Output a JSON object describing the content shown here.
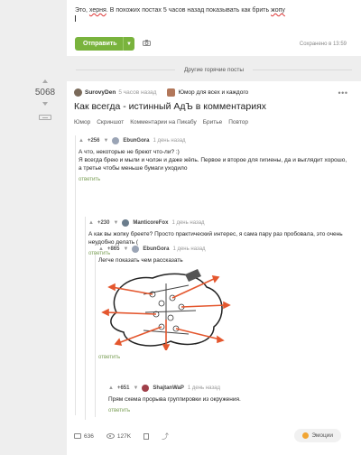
{
  "compose": {
    "text_before": "Это, ",
    "text_error1": "херня",
    "text_middle": ". В похожих постах 5 часов назад показывать как брить ",
    "text_error2": "жопу",
    "send_label": "Отправить",
    "saved_status": "Сохранено в 13:59"
  },
  "section_title": "Другие горячие посты",
  "post": {
    "rating": "5068",
    "author": "SurovyDen",
    "time": "5 часов назад",
    "community": "Юмор для всех и каждого",
    "title": "Как всегда - истинный АдЪ в комментариях",
    "tags": [
      "Юмор",
      "Скриншот",
      "Комментарии на Пикабу",
      "Бритье",
      "Повтор"
    ],
    "comments_count": "636",
    "views": "127K",
    "emotions_label": "Эмоции"
  },
  "comments": [
    {
      "rating": "+256",
      "user": "EbunGora",
      "time": "1 день назад",
      "lines": [
        "А что, некоторые не бреют что-ли? :)",
        "Я всегда брею и мыли и чолэн и даже жёпь. Первое и второе для гигиены, да и выглядит хорошо,",
        "а третье чтобы меньше бумаги уходило"
      ],
      "reply": "ответить"
    },
    {
      "rating": "+230",
      "user": "ManticoreFox",
      "time": "1 день назад",
      "lines": [
        "А как вы жопку бреете? Просто практический интерес, я сама пару раз пробовала, это очень",
        "неудобно делать ("
      ],
      "reply": "ответить"
    },
    {
      "rating": "+865",
      "user": "EbunGora",
      "time": "1 день назад",
      "lines": [
        "Легче показать чем рассказать"
      ],
      "reply": "ответить"
    },
    {
      "rating": "+651",
      "user": "ShajtanWaP",
      "time": "1 день назад",
      "lines": [
        "Прям схема прорыва группировки из окружения."
      ],
      "reply": "ответить"
    }
  ],
  "colors": {
    "accent": "#79b33d",
    "arrow": "#e4572e"
  }
}
